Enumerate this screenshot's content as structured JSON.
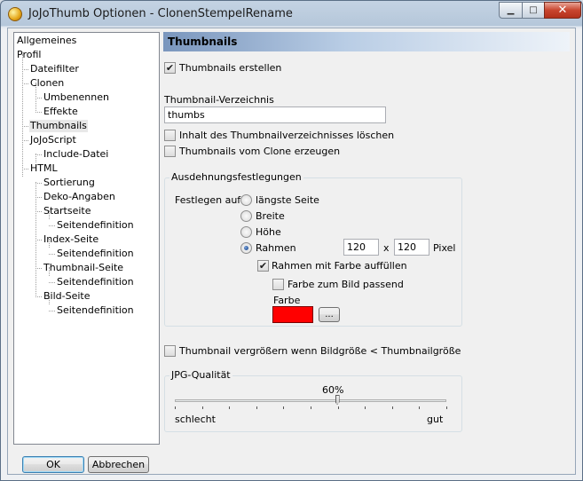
{
  "window": {
    "title": "JoJoThumb Optionen - ClonenStempelRename",
    "minimize_glyph": "▁",
    "maximize_glyph": "□",
    "close_glyph": "✕",
    "icon": "sunflower-app-icon"
  },
  "tree": {
    "items": [
      {
        "label": "Allgemeines",
        "level": 0
      },
      {
        "label": "Profil",
        "level": 0
      },
      {
        "label": "Dateifilter",
        "level": 1
      },
      {
        "label": "Clonen",
        "level": 1
      },
      {
        "label": "Umbenennen",
        "level": 2
      },
      {
        "label": "Effekte",
        "level": 2
      },
      {
        "label": "Thumbnails",
        "level": 1,
        "selected": true
      },
      {
        "label": "JoJoScript",
        "level": 1
      },
      {
        "label": "Include-Datei",
        "level": 2
      },
      {
        "label": "HTML",
        "level": 1
      },
      {
        "label": "Sortierung",
        "level": 2
      },
      {
        "label": "Deko-Angaben",
        "level": 2
      },
      {
        "label": "Startseite",
        "level": 2
      },
      {
        "label": "Seitendefinition",
        "level": 3
      },
      {
        "label": "Index-Seite",
        "level": 2
      },
      {
        "label": "Seitendefinition",
        "level": 3
      },
      {
        "label": "Thumbnail-Seite",
        "level": 2
      },
      {
        "label": "Seitendefinition",
        "level": 3
      },
      {
        "label": "Bild-Seite",
        "level": 2
      },
      {
        "label": "Seitendefinition",
        "level": 3
      }
    ]
  },
  "buttons": {
    "ok": "OK",
    "cancel": "Abbrechen",
    "color_picker": "..."
  },
  "panel": {
    "title": "Thumbnails",
    "create_thumbnails": {
      "label": "Thumbnails erstellen",
      "checked": true
    },
    "directory_label": "Thumbnail-Verzeichnis",
    "directory_value": "thumbs",
    "delete_contents": {
      "label": "Inhalt des Thumbnailverzeichnisses löschen",
      "checked": false
    },
    "from_clone": {
      "label": "Thumbnails vom Clone erzeugen",
      "checked": false
    },
    "dimensions": {
      "group_title": "Ausdehnungsfestlegungen",
      "set_on_label": "Festlegen auf",
      "options": [
        {
          "label": "längste Seite",
          "selected": false
        },
        {
          "label": "Breite",
          "selected": false
        },
        {
          "label": "Höhe",
          "selected": false
        },
        {
          "label": "Rahmen",
          "selected": true
        }
      ],
      "width": "120",
      "times": "x",
      "height": "120",
      "unit": "Pixel",
      "frame_with_color": {
        "label": "Rahmen mit Farbe auffüllen",
        "checked": true
      },
      "color_matches_image": {
        "label": "Farbe zum Bild passend",
        "checked": false
      },
      "color_label": "Farbe",
      "color_value": "#ff0000"
    },
    "enlarge": {
      "label": "Thumbnail vergrößern wenn Bildgröße < Thumbnailgröße",
      "checked": false
    },
    "jpg_quality": {
      "group_title": "JPG-Qualität",
      "value_text": "60%",
      "value": 60,
      "min_label": "schlecht",
      "max_label": "gut"
    }
  },
  "colors": {
    "header_gradient_start": "#7a96bd",
    "header_gradient_end": "#eef3f9",
    "accent_blue": "#3c7fb1",
    "swatch": "#ff0000"
  }
}
